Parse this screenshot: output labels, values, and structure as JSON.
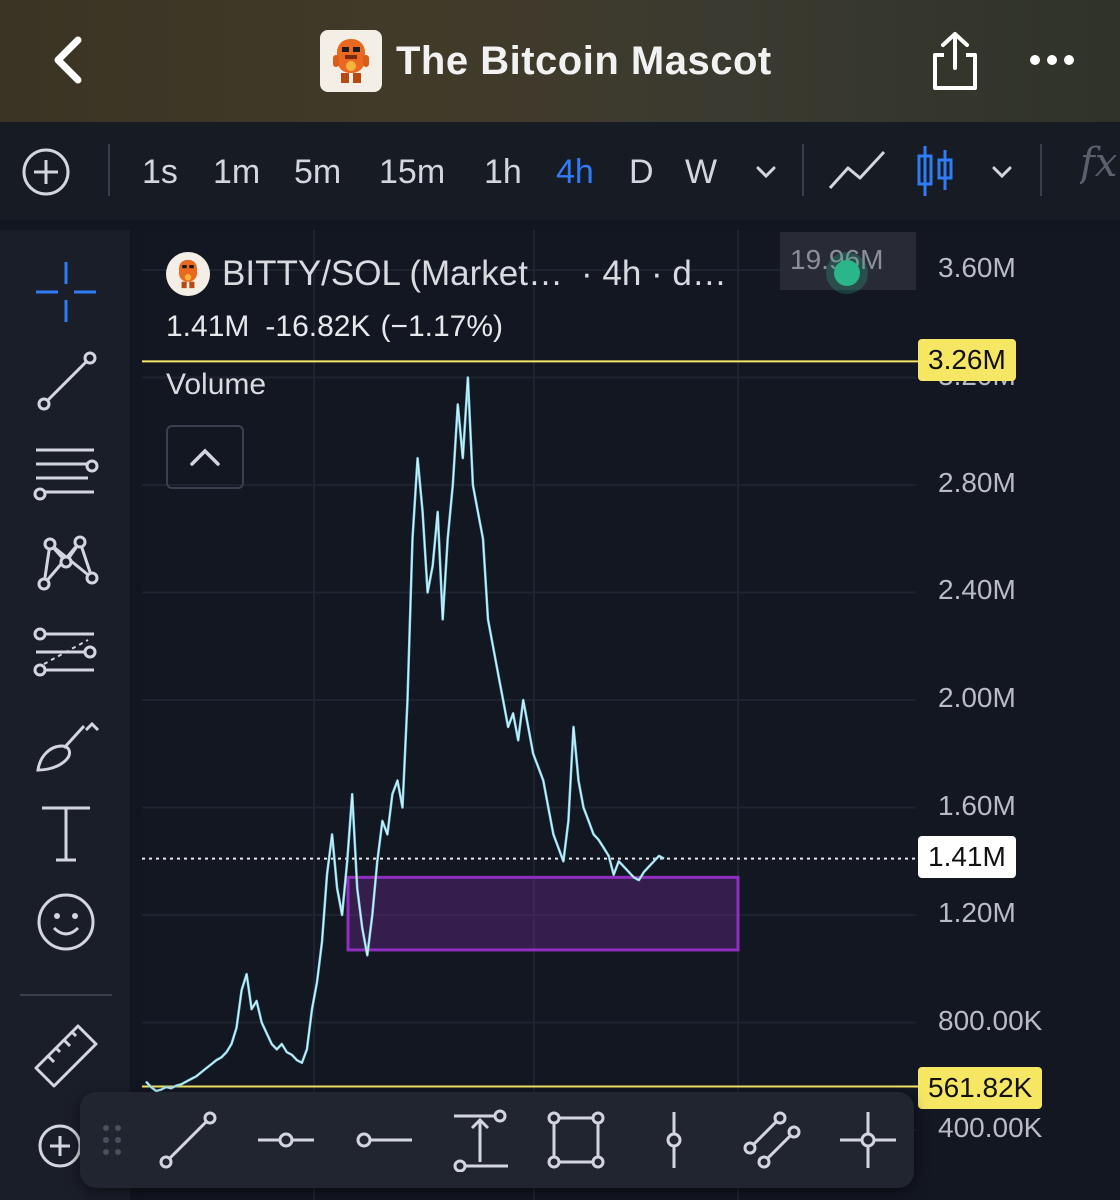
{
  "header": {
    "title": "The Bitcoin Mascot"
  },
  "toolbar": {
    "add_label": "+",
    "intervals": [
      {
        "label": "1s",
        "active": false
      },
      {
        "label": "1m",
        "active": false
      },
      {
        "label": "5m",
        "active": false
      },
      {
        "label": "15m",
        "active": false
      },
      {
        "label": "1h",
        "active": false
      },
      {
        "label": "4h",
        "active": true
      },
      {
        "label": "D",
        "active": false
      },
      {
        "label": "W",
        "active": false
      }
    ],
    "indicators_label": "fx"
  },
  "left_tools": [
    {
      "name": "crosshair-icon"
    },
    {
      "name": "trend-line-icon"
    },
    {
      "name": "fib-lines-icon"
    },
    {
      "name": "pattern-icon"
    },
    {
      "name": "projection-icon"
    },
    {
      "name": "brush-icon"
    },
    {
      "name": "text-icon"
    },
    {
      "name": "emoji-icon"
    },
    {
      "name": "ruler-icon"
    },
    {
      "name": "zoom-in-icon"
    }
  ],
  "legend": {
    "symbol": "BITTY/SOL (Market…",
    "interval": "· 4h · d…",
    "price": "1.41M",
    "change": "-16.82K",
    "change_pct": "(−1.17%)",
    "volume_label": "Volume",
    "volume_value": "19.96M"
  },
  "axis": {
    "labels": [
      "3.60M",
      "3.20M",
      "2.80M",
      "2.40M",
      "2.00M",
      "1.60M",
      "1.20M",
      "800.00K",
      "400.00K"
    ]
  },
  "price_tags": {
    "upper": "3.26M",
    "current": "1.41M",
    "lower": "561.82K"
  },
  "colors": {
    "accent": "#2f7cf6",
    "line": "#7fd3e8",
    "level": "#f5e663",
    "zone": "#8e2fc0"
  },
  "bottom_tools": [
    {
      "name": "trend-line-tool-icon"
    },
    {
      "name": "horizontal-ray-icon"
    },
    {
      "name": "horizontal-line-icon"
    },
    {
      "name": "price-range-icon"
    },
    {
      "name": "rectangle-icon"
    },
    {
      "name": "vertical-line-icon"
    },
    {
      "name": "parallel-channel-icon"
    },
    {
      "name": "cross-line-icon"
    }
  ],
  "chart_data": {
    "type": "line",
    "symbol": "BITTY/SOL",
    "interval": "4h",
    "ylim": [
      400000,
      3600000
    ],
    "yticks": [
      3600000,
      3200000,
      2800000,
      2400000,
      2000000,
      1600000,
      1200000,
      800000,
      400000
    ],
    "levels": {
      "upper": 3260000,
      "current": 1410000,
      "lower": 561820
    },
    "zone": {
      "low": 1070000,
      "high": 1340000
    },
    "series": [
      {
        "values": [
          580000,
          560000,
          545000,
          550000,
          560000,
          555000,
          565000,
          570000,
          580000,
          590000,
          600000,
          615000,
          630000,
          645000,
          660000,
          670000,
          690000,
          720000,
          780000,
          920000,
          980000,
          850000,
          880000,
          800000,
          760000,
          720000,
          700000,
          720000,
          690000,
          680000,
          660000,
          650000,
          700000,
          850000,
          950000,
          1100000,
          1350000,
          1500000,
          1300000,
          1200000,
          1400000,
          1650000,
          1300000,
          1150000,
          1050000,
          1200000,
          1400000,
          1550000,
          1500000,
          1650000,
          1700000,
          1600000,
          2000000,
          2600000,
          2900000,
          2700000,
          2400000,
          2500000,
          2700000,
          2300000,
          2600000,
          2800000,
          3100000,
          2900000,
          3200000,
          2800000,
          2700000,
          2600000,
          2300000,
          2200000,
          2100000,
          2000000,
          1900000,
          1950000,
          1850000,
          2000000,
          1900000,
          1800000,
          1750000,
          1700000,
          1600000,
          1500000,
          1450000,
          1400000,
          1550000,
          1900000,
          1700000,
          1600000,
          1550000,
          1500000,
          1480000,
          1450000,
          1420000,
          1350000,
          1400000,
          1380000,
          1360000,
          1340000,
          1330000,
          1360000,
          1380000,
          1400000,
          1420000,
          1410000
        ]
      }
    ]
  }
}
